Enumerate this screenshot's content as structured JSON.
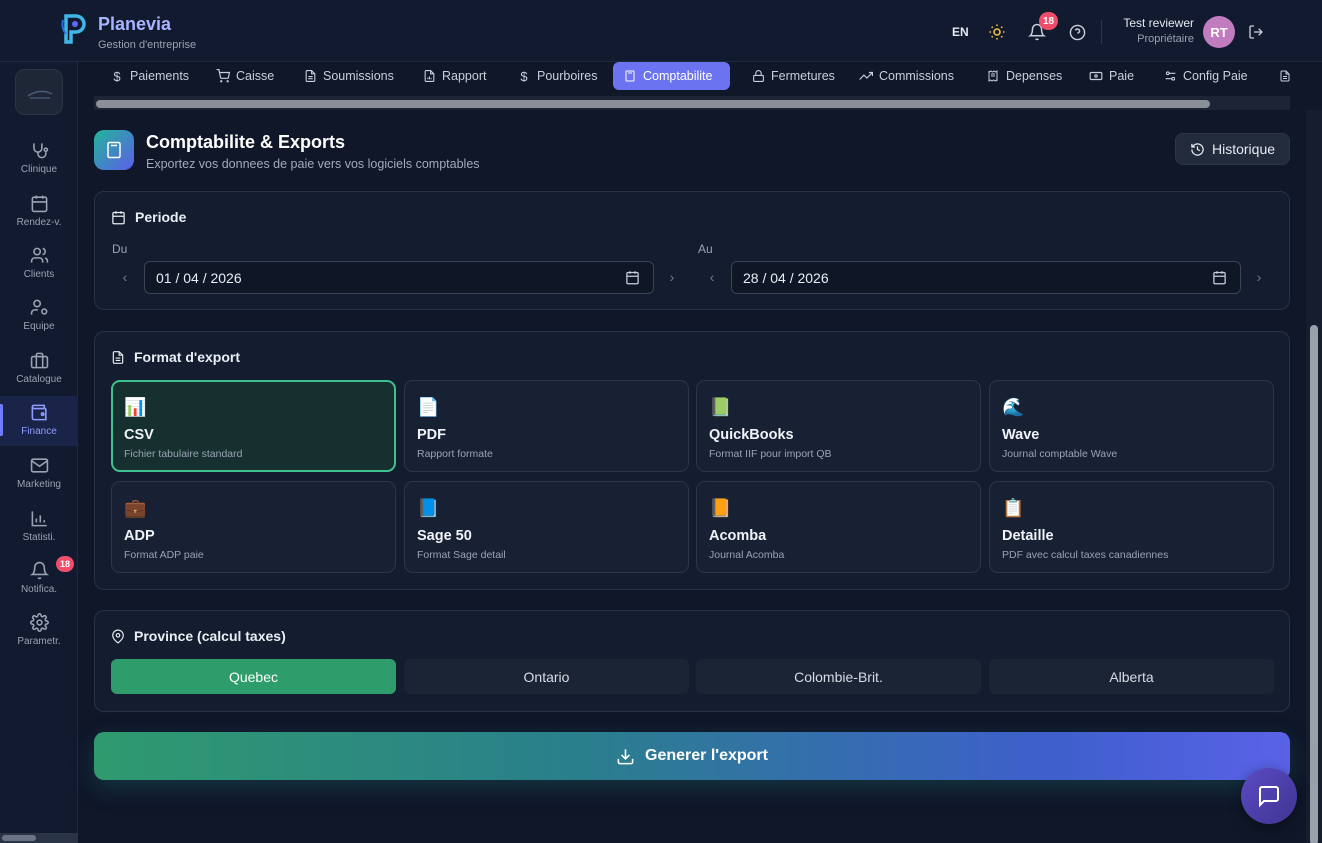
{
  "app": {
    "name": "Planevia",
    "subtitle": "Gestion d'entreprise"
  },
  "header": {
    "lang": "EN",
    "notif_count": "18",
    "user_name": "Test reviewer",
    "user_role": "Propriétaire",
    "avatar_initials": "RT"
  },
  "sidebar": {
    "items": [
      {
        "label": "Clinique",
        "icon": "stethoscope-icon"
      },
      {
        "label": "Rendez-v.",
        "icon": "calendar-icon"
      },
      {
        "label": "Clients",
        "icon": "users-icon"
      },
      {
        "label": "Equipe",
        "icon": "user-cog-icon"
      },
      {
        "label": "Catalogue",
        "icon": "briefcase-icon"
      },
      {
        "label": "Finance",
        "icon": "wallet-icon"
      },
      {
        "label": "Marketing",
        "icon": "mail-icon"
      },
      {
        "label": "Statisti.",
        "icon": "bar-chart-icon"
      },
      {
        "label": "Notifica.",
        "icon": "bell-icon"
      },
      {
        "label": "Parametr.",
        "icon": "gear-icon"
      }
    ],
    "notif_badge": "18",
    "active": "Finance"
  },
  "tabs": [
    {
      "label": "Paiements",
      "icon": "dollar-icon"
    },
    {
      "label": "Caisse",
      "icon": "cart-icon"
    },
    {
      "label": "Soumissions",
      "icon": "file-icon"
    },
    {
      "label": "Rapport",
      "icon": "file-chart-icon"
    },
    {
      "label": "Pourboires",
      "icon": "dollar-icon"
    },
    {
      "label": "Comptabilite",
      "icon": "calculator-icon"
    },
    {
      "label": "Fermetures",
      "icon": "lock-icon"
    },
    {
      "label": "Commissions",
      "icon": "trending-up-icon"
    },
    {
      "label": "Depenses",
      "icon": "receipt-icon"
    },
    {
      "label": "Paie",
      "icon": "banknote-icon"
    },
    {
      "label": "Config Paie",
      "icon": "sliders-icon"
    }
  ],
  "page": {
    "title": "Comptabilite & Exports",
    "subtitle": "Exportez vos donnees de paie vers vos logiciels comptables",
    "history_button": "Historique"
  },
  "period": {
    "title": "Periode",
    "from_label": "Du",
    "from_value": "01 / 04 / 2026",
    "to_label": "Au",
    "to_value": "28 / 04 / 2026"
  },
  "export_format": {
    "title": "Format d'export",
    "selected": "CSV",
    "options": [
      {
        "emoji": "📊",
        "name": "CSV",
        "desc": "Fichier tabulaire standard"
      },
      {
        "emoji": "📄",
        "name": "PDF",
        "desc": "Rapport formate"
      },
      {
        "emoji": "📗",
        "name": "QuickBooks",
        "desc": "Format IIF pour import QB"
      },
      {
        "emoji": "🌊",
        "name": "Wave",
        "desc": "Journal comptable Wave"
      },
      {
        "emoji": "💼",
        "name": "ADP",
        "desc": "Format ADP paie"
      },
      {
        "emoji": "📘",
        "name": "Sage 50",
        "desc": "Format Sage detail"
      },
      {
        "emoji": "📙",
        "name": "Acomba",
        "desc": "Journal Acomba"
      },
      {
        "emoji": "📋",
        "name": "Detaille",
        "desc": "PDF avec calcul taxes canadiennes"
      }
    ]
  },
  "province": {
    "title": "Province (calcul taxes)",
    "selected": "Quebec",
    "options": [
      "Quebec",
      "Ontario",
      "Colombie-Brit.",
      "Alberta"
    ]
  },
  "generate_button": "Generer l'export",
  "colors": {
    "accent": "#6b73f0",
    "success": "#2e9d6b",
    "selected_border": "#3ec08f",
    "badge": "#ef4d6a"
  }
}
